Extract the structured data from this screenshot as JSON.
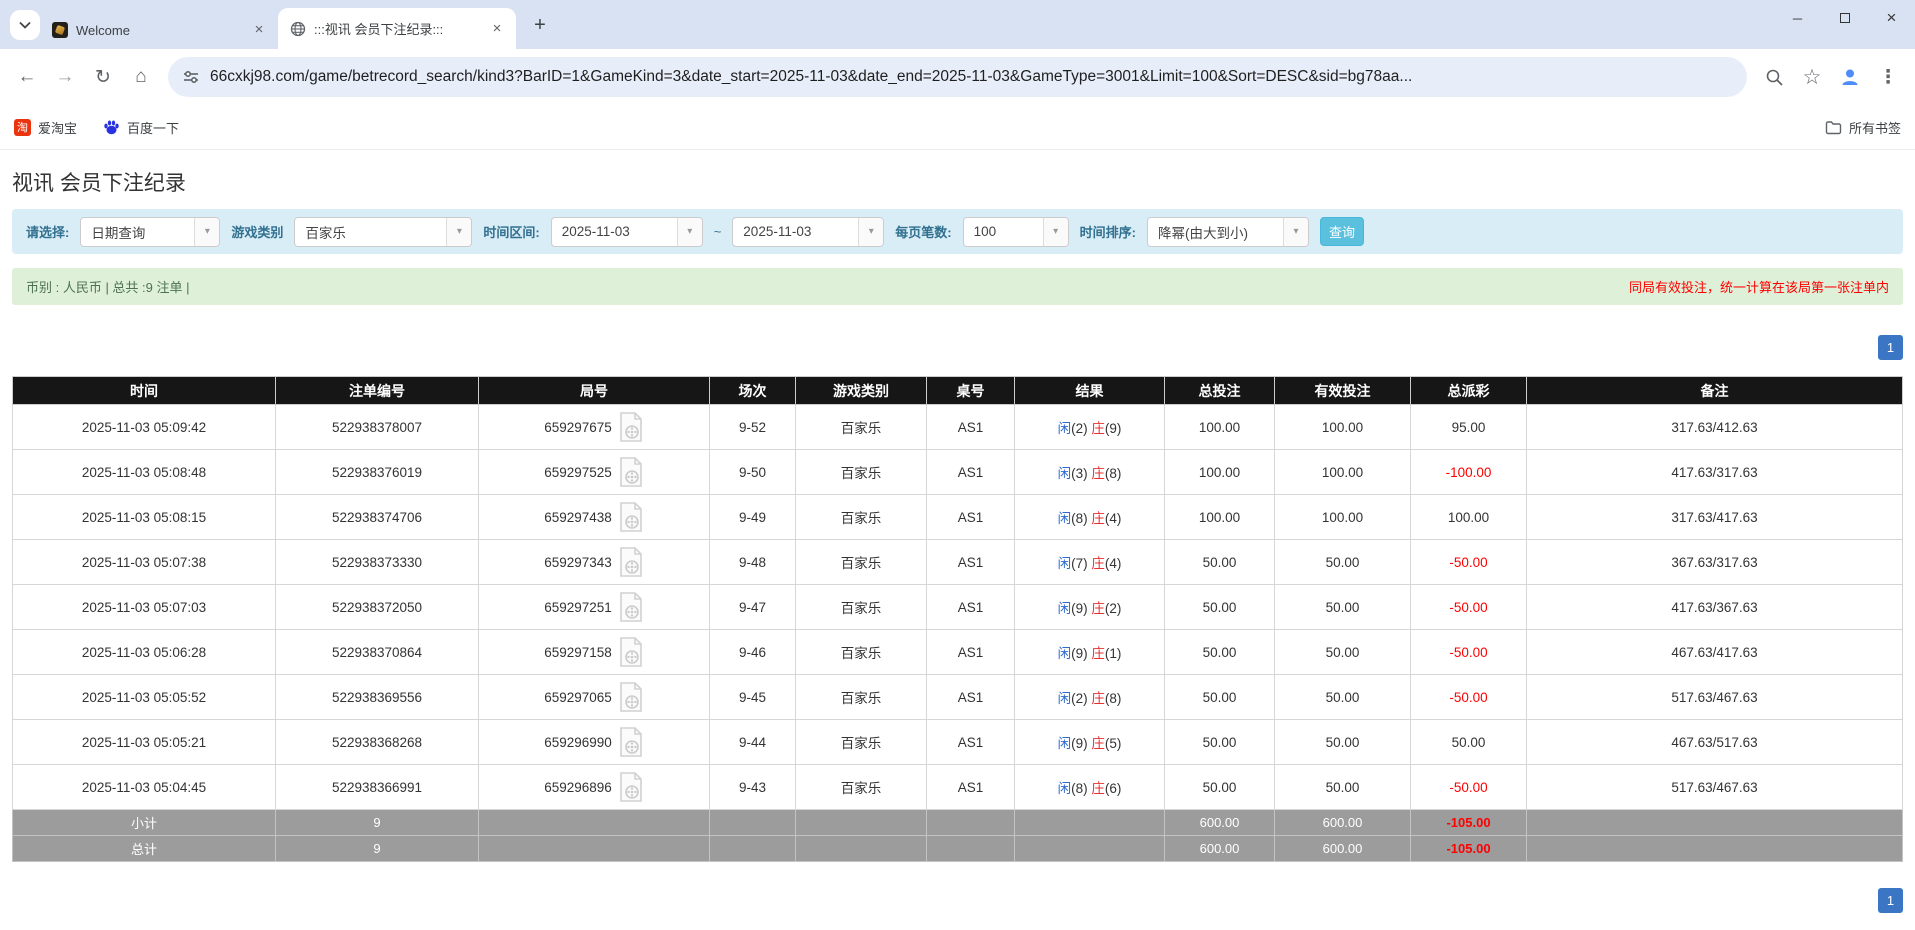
{
  "browser": {
    "tabs": [
      {
        "title": "Welcome"
      },
      {
        "title": ":::视讯 会员下注纪录:::"
      }
    ],
    "url": "66cxkj98.com/game/betrecord_search/kind3?BarID=1&GameKind=3&date_start=2025-11-03&date_end=2025-11-03&GameType=3001&Limit=100&Sort=DESC&sid=bg78aa...",
    "bookmarks": {
      "taobao": "爱淘宝",
      "baidu": "百度一下",
      "all_bookmarks": "所有书签"
    },
    "window": {
      "minimize": "─",
      "close": "×"
    },
    "icons": {
      "back": "←",
      "forward": "→",
      "reload": "↻",
      "home": "⌂",
      "star": "☆",
      "menu": "⋮",
      "new_tab": "+",
      "tab_close": "×",
      "dropdown": "▾",
      "taobao_glyph": "淘"
    }
  },
  "page": {
    "title": "视讯 会员下注纪录",
    "filters": {
      "select_label": "请选择:",
      "select_value": "日期查询",
      "game_label": "游戏类别",
      "game_value": "百家乐",
      "range_label": "时间区间:",
      "date_start": "2025-11-03",
      "tilde": "~",
      "date_end": "2025-11-03",
      "limit_label": "每页笔数:",
      "limit_value": "100",
      "sort_label": "时间排序:",
      "sort_value": "降幂(由大到小)",
      "search_button": "查询"
    },
    "summary": {
      "left": "币别 : 人民币 | 总共 :9 注单 |",
      "right": "同局有效投注，统一计算在该局第一张注单内"
    },
    "pagination": {
      "page": "1"
    },
    "table": {
      "headers": [
        "时间",
        "注单编号",
        "局号",
        "场次",
        "游戏类别",
        "桌号",
        "结果",
        "总投注",
        "有效投注",
        "总派彩",
        "备注"
      ],
      "rows": [
        {
          "time": "2025-11-03 05:09:42",
          "bet_id": "522938378007",
          "round": "659297675",
          "session": "9-52",
          "game": "百家乐",
          "table": "AS1",
          "result_p": "闲",
          "result_pn": "(2)",
          "result_b": "庄",
          "result_bn": "(9)",
          "total_bet": "100.00",
          "valid_bet": "100.00",
          "payout": "95.00",
          "note": "317.63/412.63"
        },
        {
          "time": "2025-11-03 05:08:48",
          "bet_id": "522938376019",
          "round": "659297525",
          "session": "9-50",
          "game": "百家乐",
          "table": "AS1",
          "result_p": "闲",
          "result_pn": "(3)",
          "result_b": "庄",
          "result_bn": "(8)",
          "total_bet": "100.00",
          "valid_bet": "100.00",
          "payout": "-100.00",
          "note": "417.63/317.63"
        },
        {
          "time": "2025-11-03 05:08:15",
          "bet_id": "522938374706",
          "round": "659297438",
          "session": "9-49",
          "game": "百家乐",
          "table": "AS1",
          "result_p": "闲",
          "result_pn": "(8)",
          "result_b": "庄",
          "result_bn": "(4)",
          "total_bet": "100.00",
          "valid_bet": "100.00",
          "payout": "100.00",
          "note": "317.63/417.63"
        },
        {
          "time": "2025-11-03 05:07:38",
          "bet_id": "522938373330",
          "round": "659297343",
          "session": "9-48",
          "game": "百家乐",
          "table": "AS1",
          "result_p": "闲",
          "result_pn": "(7)",
          "result_b": "庄",
          "result_bn": "(4)",
          "total_bet": "50.00",
          "valid_bet": "50.00",
          "payout": "-50.00",
          "note": "367.63/317.63"
        },
        {
          "time": "2025-11-03 05:07:03",
          "bet_id": "522938372050",
          "round": "659297251",
          "session": "9-47",
          "game": "百家乐",
          "table": "AS1",
          "result_p": "闲",
          "result_pn": "(9)",
          "result_b": "庄",
          "result_bn": "(2)",
          "total_bet": "50.00",
          "valid_bet": "50.00",
          "payout": "-50.00",
          "note": "417.63/367.63"
        },
        {
          "time": "2025-11-03 05:06:28",
          "bet_id": "522938370864",
          "round": "659297158",
          "session": "9-46",
          "game": "百家乐",
          "table": "AS1",
          "result_p": "闲",
          "result_pn": "(9)",
          "result_b": "庄",
          "result_bn": "(1)",
          "total_bet": "50.00",
          "valid_bet": "50.00",
          "payout": "-50.00",
          "note": "467.63/417.63"
        },
        {
          "time": "2025-11-03 05:05:52",
          "bet_id": "522938369556",
          "round": "659297065",
          "session": "9-45",
          "game": "百家乐",
          "table": "AS1",
          "result_p": "闲",
          "result_pn": "(2)",
          "result_b": "庄",
          "result_bn": "(8)",
          "total_bet": "50.00",
          "valid_bet": "50.00",
          "payout": "-50.00",
          "note": "517.63/467.63"
        },
        {
          "time": "2025-11-03 05:05:21",
          "bet_id": "522938368268",
          "round": "659296990",
          "session": "9-44",
          "game": "百家乐",
          "table": "AS1",
          "result_p": "闲",
          "result_pn": "(9)",
          "result_b": "庄",
          "result_bn": "(5)",
          "total_bet": "50.00",
          "valid_bet": "50.00",
          "payout": "50.00",
          "note": "467.63/517.63"
        },
        {
          "time": "2025-11-03 05:04:45",
          "bet_id": "522938366991",
          "round": "659296896",
          "session": "9-43",
          "game": "百家乐",
          "table": "AS1",
          "result_p": "闲",
          "result_pn": "(8)",
          "result_b": "庄",
          "result_bn": "(6)",
          "total_bet": "50.00",
          "valid_bet": "50.00",
          "payout": "-50.00",
          "note": "517.63/467.63"
        }
      ],
      "subtotal": {
        "label": "小计",
        "count": "9",
        "total_bet": "600.00",
        "valid_bet": "600.00",
        "payout": "-105.00"
      },
      "total": {
        "label": "总计",
        "count": "9",
        "total_bet": "600.00",
        "valid_bet": "600.00",
        "payout": "-105.00"
      }
    },
    "colors": {
      "accent_blue": "#2e6bd0",
      "banker_red": "#e53030",
      "negative_red": "#ff0000",
      "filter_bg": "#d9edf7",
      "summary_bg": "#dff0d8",
      "header_bg": "#161616",
      "footer_gray": "#9c9c9c",
      "pager_blue": "#3a76c3",
      "search_btn": "#5bc0de"
    }
  }
}
